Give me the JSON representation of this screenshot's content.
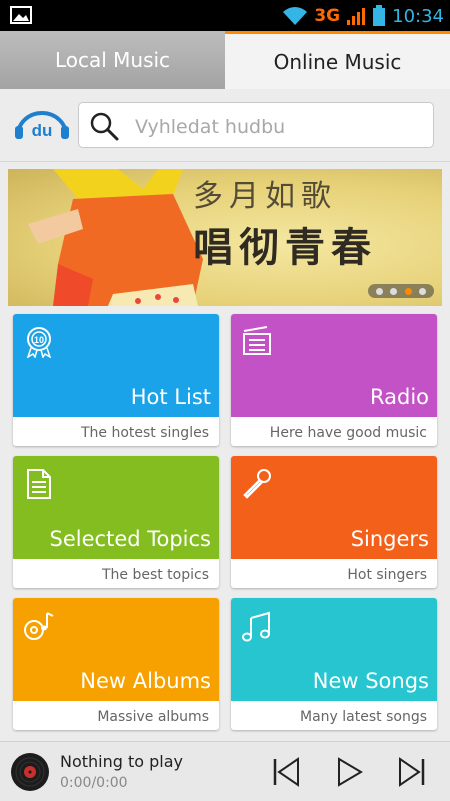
{
  "status_bar": {
    "network": "3G",
    "time": "10:34"
  },
  "tabs": {
    "local": "Local Music",
    "online": "Online Music"
  },
  "search": {
    "placeholder": "Vyhledat hudbu",
    "logo_text": "du"
  },
  "banner": {
    "line1": "多月如歌",
    "line2": "唱彻青春",
    "dots": 4,
    "active_dot": 3
  },
  "categories": [
    {
      "title": "Hot List",
      "subtitle": "The hotest singles",
      "color": "#1aa3e8",
      "icon": "top-10-badge-icon"
    },
    {
      "title": "Radio",
      "subtitle": "Here have good music",
      "color": "#c452c7",
      "icon": "radio-icon"
    },
    {
      "title": "Selected Topics",
      "subtitle": "The best topics",
      "color": "#84bd1f",
      "icon": "document-icon"
    },
    {
      "title": "Singers",
      "subtitle": "Hot singers",
      "color": "#f2601a",
      "icon": "microphone-icon"
    },
    {
      "title": "New Albums",
      "subtitle": "Massive albums",
      "color": "#f6a100",
      "icon": "album-note-icon"
    },
    {
      "title": "New Songs",
      "subtitle": "Many latest songs",
      "color": "#26c5cf",
      "icon": "music-note-icon"
    }
  ],
  "player": {
    "title": "Nothing to play",
    "time": "0:00/0:00"
  },
  "colors": {
    "accent": "#ff8a00",
    "status_blue": "#33b5e5"
  }
}
